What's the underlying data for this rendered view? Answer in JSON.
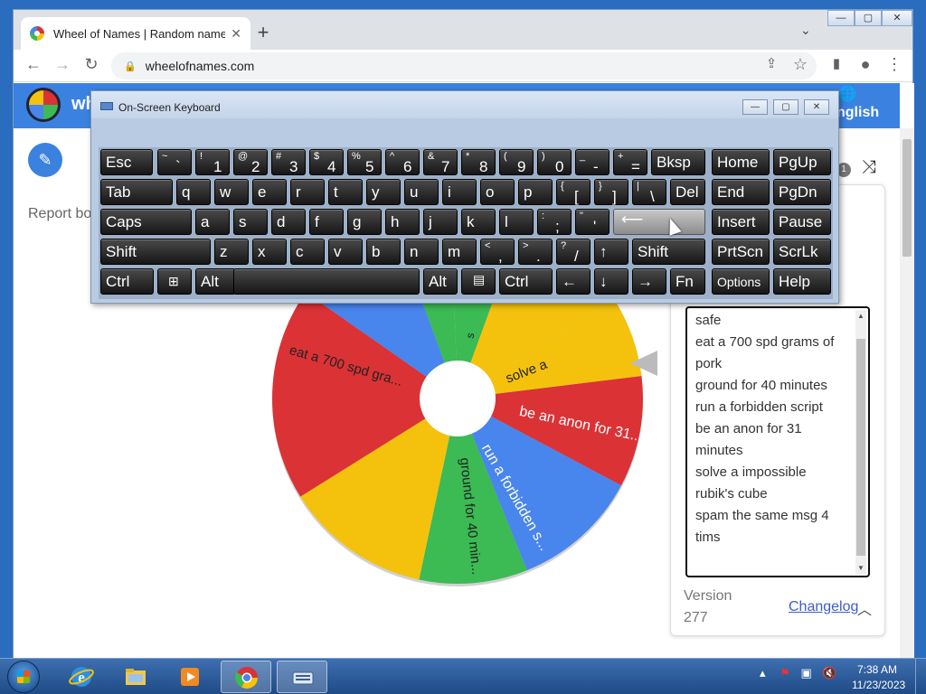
{
  "browser": {
    "tab_title": "Wheel of Names | Random name",
    "url": "wheelofnames.com",
    "new_tab": "+",
    "tab_close": "✕",
    "window_controls": [
      "—",
      "▢",
      "✕"
    ]
  },
  "site": {
    "name": "wh",
    "language": "nglish",
    "report_text": "Report bo",
    "counter": "1",
    "entries": [
      "safe",
      "eat a 700 spd grams of",
      "pork",
      "ground for 40 minutes",
      "run a forbidden script",
      "be an anon for 31",
      "minutes",
      "solve a impossible",
      "rubik's cube",
      "spam the same msg 4",
      "tims"
    ],
    "version_label": "Version",
    "version_number": "277",
    "changelog": "Changelog"
  },
  "wheel": {
    "colors": {
      "red": "#db3236",
      "yellow": "#f4c20d",
      "green": "#3cba54",
      "blue": "#4885ed"
    },
    "segment_labels": [
      "be an anon for 31...",
      "run a forbidden s...",
      "ground for 40 min...",
      "eat a 700 spd gra...",
      "solve a",
      "sos",
      "s"
    ]
  },
  "osk": {
    "title": "On-Screen Keyboard",
    "keys": {
      "esc": "Esc",
      "tilde_top": "~",
      "tilde_bot": "`",
      "n1_top": "!",
      "n1": "1",
      "n2_top": "@",
      "n2": "2",
      "n3_top": "#",
      "n3": "3",
      "n4_top": "$",
      "n4": "4",
      "n5_top": "%",
      "n5": "5",
      "n6_top": "^",
      "n6": "6",
      "n7_top": "&",
      "n7": "7",
      "n8_top": "*",
      "n8": "8",
      "n9_top": "(",
      "n9": "9",
      "n0_top": ")",
      "n0": "0",
      "minus_top": "_",
      "minus": "-",
      "plus_top": "+",
      "plus": "=",
      "bksp": "Bksp",
      "home": "Home",
      "pgup": "PgUp",
      "tab": "Tab",
      "q": "q",
      "w": "w",
      "e": "e",
      "r": "r",
      "t": "t",
      "y": "y",
      "u": "u",
      "i": "i",
      "o": "o",
      "p": "p",
      "lbr_top": "{",
      "lbr": "[",
      "rbr_top": "}",
      "rbr": "]",
      "bsl_top": "|",
      "bsl": "\\",
      "del": "Del",
      "end": "End",
      "pgdn": "PgDn",
      "caps": "Caps",
      "a": "a",
      "s": "s",
      "d": "d",
      "f": "f",
      "g": "g",
      "h": "h",
      "j": "j",
      "k": "k",
      "l": "l",
      "semi_top": ":",
      "semi": ";",
      "quote_top": "\"",
      "quote": "'",
      "enter": "⟵",
      "insert": "Insert",
      "pause": "Pause",
      "shift": "Shift",
      "z": "z",
      "x": "x",
      "c": "c",
      "v": "v",
      "b": "b",
      "n": "n",
      "m": "m",
      "comma_top": "<",
      "comma": ",",
      "period_top": ">",
      "period": ".",
      "slash_top": "?",
      "slash": "/",
      "up": "↑",
      "shift_r": "Shift",
      "prtscn": "PrtScn",
      "scrlk": "ScrLk",
      "ctrl": "Ctrl",
      "alt": "Alt",
      "alt_r": "Alt",
      "ctrl_r": "Ctrl",
      "left": "←",
      "down": "↓",
      "right": "→",
      "fn": "Fn",
      "options": "Options",
      "help": "Help"
    }
  },
  "taskbar": {
    "time": "7:38 AM",
    "date": "11/23/2023"
  }
}
